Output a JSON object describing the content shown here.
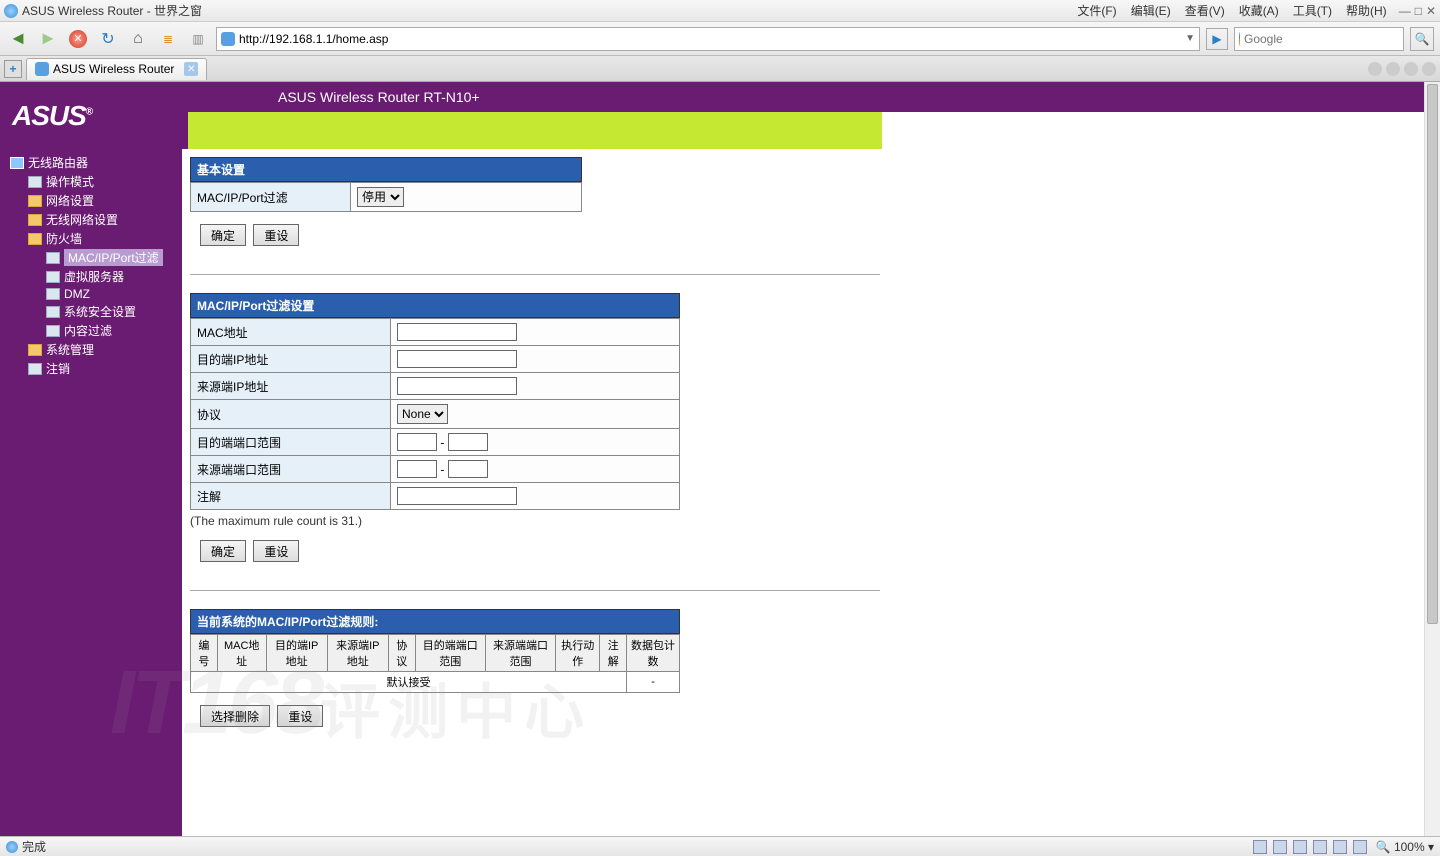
{
  "window": {
    "title": "ASUS Wireless Router - 世界之窗",
    "menu": [
      "文件(F)",
      "编辑(E)",
      "查看(V)",
      "收藏(A)",
      "工具(T)",
      "帮助(H)"
    ],
    "url": "http://192.168.1.1/home.asp",
    "search_placeholder": "Google",
    "tab_label": "ASUS Wireless Router",
    "status": "完成",
    "zoom": "100%"
  },
  "banner": "ASUS Wireless Router RT-N10+",
  "logo": "ASUS",
  "sidebar": {
    "root": "无线路由器",
    "items": [
      {
        "label": "操作模式",
        "indent": 1,
        "icon": "page"
      },
      {
        "label": "网络设置",
        "indent": 1,
        "icon": "fold"
      },
      {
        "label": "无线网络设置",
        "indent": 1,
        "icon": "fold"
      },
      {
        "label": "防火墙",
        "indent": 1,
        "icon": "fold-open"
      },
      {
        "label": "MAC/IP/Port过滤",
        "indent": 2,
        "icon": "page",
        "selected": true
      },
      {
        "label": "虚拟服务器",
        "indent": 2,
        "icon": "page"
      },
      {
        "label": "DMZ",
        "indent": 2,
        "icon": "page"
      },
      {
        "label": "系统安全设置",
        "indent": 2,
        "icon": "page"
      },
      {
        "label": "内容过滤",
        "indent": 2,
        "icon": "page"
      },
      {
        "label": "系统管理",
        "indent": 1,
        "icon": "fold"
      },
      {
        "label": "注销",
        "indent": 1,
        "icon": "page"
      }
    ]
  },
  "basic": {
    "header": "基本设置",
    "filter_label": "MAC/IP/Port过滤",
    "filter_value": "停用",
    "btn_ok": "确定",
    "btn_reset": "重设"
  },
  "settings": {
    "header": "MAC/IP/Port过滤设置",
    "rows": {
      "mac": "MAC地址",
      "dst_ip": "目的端IP地址",
      "src_ip": "来源端IP地址",
      "proto": "协议",
      "proto_value": "None",
      "dst_port": "目的端端口范围",
      "src_port": "来源端端口范围",
      "comment": "注解"
    },
    "note": "(The maximum rule count is 31.)",
    "btn_ok": "确定",
    "btn_reset": "重设"
  },
  "rules": {
    "header": "当前系统的MAC/IP/Port过滤规则:",
    "cols": [
      "编号",
      "MAC地址",
      "目的端IP地址",
      "来源端IP地址",
      "协议",
      "目的端端口范围",
      "来源端端口范围",
      "执行动作",
      "注解",
      "数据包计数"
    ],
    "default_row": "默认接受",
    "dash": "-",
    "btn_del": "选择删除",
    "btn_reset": "重设"
  },
  "watermark": {
    "a": "IT168",
    "b": "评测中心"
  }
}
